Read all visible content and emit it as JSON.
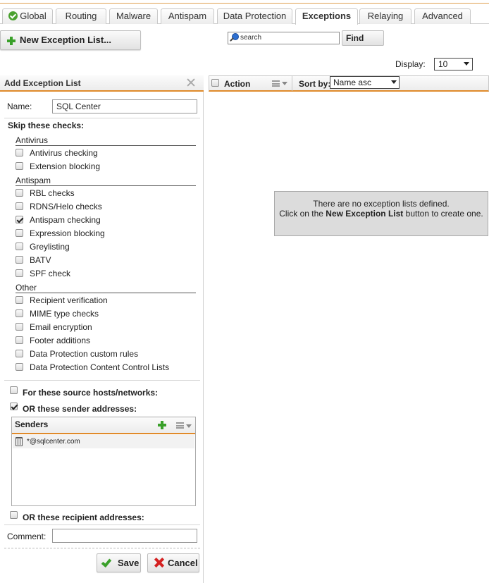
{
  "tabs": [
    {
      "label": "Global",
      "icon": "check-circle-icon"
    },
    {
      "label": "Routing"
    },
    {
      "label": "Malware"
    },
    {
      "label": "Antispam"
    },
    {
      "label": "Data Protection"
    },
    {
      "label": "Exceptions",
      "active": true
    },
    {
      "label": "Relaying"
    },
    {
      "label": "Advanced"
    }
  ],
  "toolbar": {
    "new_button": "New Exception List...",
    "search_value": "search",
    "find_button": "Find",
    "display_label": "Display:",
    "display_value": "10"
  },
  "panel": {
    "title": "Add Exception List",
    "name_label": "Name:",
    "name_value": "SQL Center",
    "skip_label": "Skip these checks:",
    "groups": [
      {
        "title": "Antivirus",
        "items": [
          {
            "label": "Antivirus checking",
            "checked": false
          },
          {
            "label": "Extension blocking",
            "checked": false
          }
        ]
      },
      {
        "title": "Antispam",
        "items": [
          {
            "label": "RBL checks",
            "checked": false
          },
          {
            "label": "RDNS/Helo checks",
            "checked": false
          },
          {
            "label": "Antispam checking",
            "checked": true
          },
          {
            "label": "Expression blocking",
            "checked": false
          },
          {
            "label": "Greylisting",
            "checked": false
          },
          {
            "label": "BATV",
            "checked": false
          },
          {
            "label": "SPF check",
            "checked": false
          }
        ]
      },
      {
        "title": "Other",
        "items": [
          {
            "label": "Recipient verification",
            "checked": false
          },
          {
            "label": "MIME type checks",
            "checked": false
          },
          {
            "label": "Email encryption",
            "checked": false
          },
          {
            "label": "Footer additions",
            "checked": false
          },
          {
            "label": "Data Protection custom rules",
            "checked": false
          },
          {
            "label": "Data Protection Content Control Lists",
            "checked": false
          }
        ]
      }
    ],
    "source_hosts_label": "For these source hosts/networks:",
    "source_hosts_checked": false,
    "sender_label": "OR these sender addresses:",
    "sender_checked": true,
    "senders_title": "Senders",
    "senders": [
      "*@sqlcenter.com"
    ],
    "recipient_label": "OR these recipient addresses:",
    "recipient_checked": false,
    "comment_label": "Comment:",
    "comment_value": "",
    "save_button": "Save",
    "cancel_button": "Cancel"
  },
  "grid": {
    "action_label": "Action",
    "sort_label": "Sort by:",
    "sort_value": "Name asc",
    "empty_line1": "There are no exception lists defined.",
    "empty_line2_pre": "Click on the ",
    "empty_line2_bold": "New Exception List",
    "empty_line2_post": " button to create one."
  },
  "colors": {
    "accent": "#e08a2a",
    "plus_green": "#3aa02a",
    "cancel_red": "#d42020"
  }
}
